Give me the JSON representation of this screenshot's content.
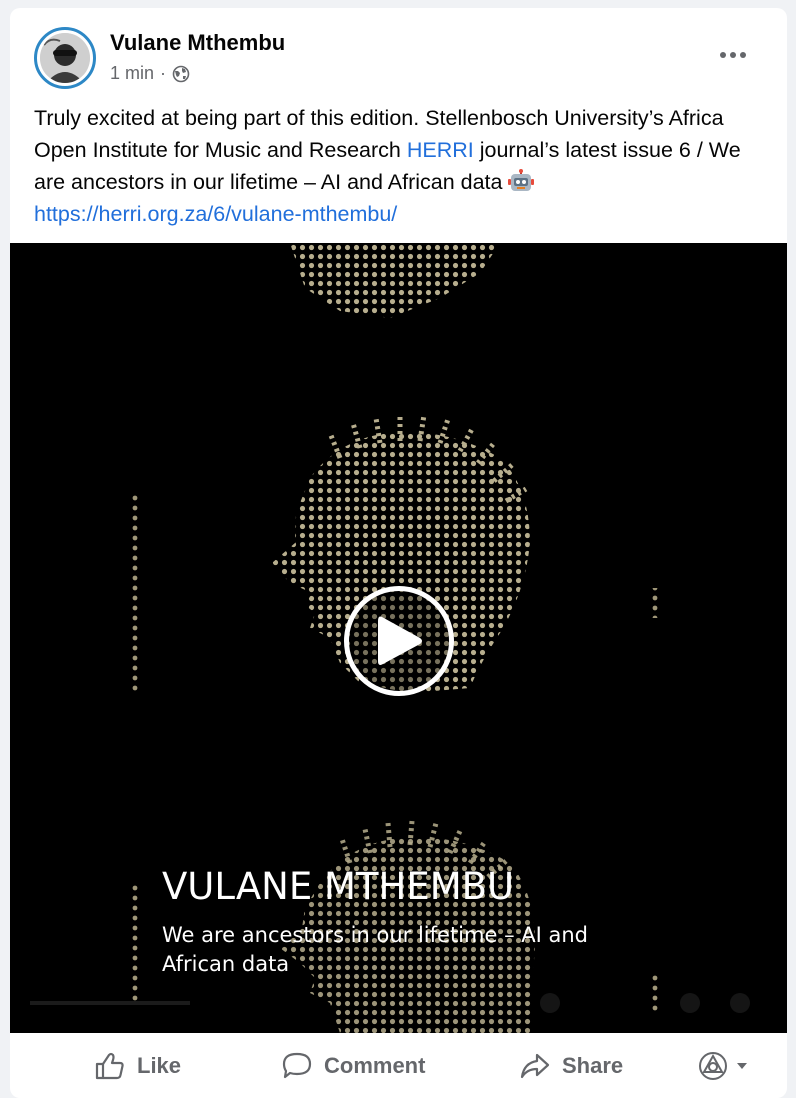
{
  "post": {
    "author": "Vulane Mthembu",
    "time": "1 min",
    "separator": "·",
    "privacy_icon": "globe-icon",
    "text_part1": "Truly excited at being part of this edition. Stellenbosch University’s Africa Open Institute for Music and Research ",
    "link_herri": "HERRI",
    "text_part2": " journal’s  latest issue 6 / We are ancestors in our lifetime – AI and African data ",
    "emoji": "robot-emoji",
    "url": "https://herri.org.za/6/vulane-mthembu/"
  },
  "video": {
    "title": "VULANE MTHEMBU",
    "subtitle": "We are ancestors in our lifetime – AI and African data"
  },
  "actions": {
    "like": "Like",
    "comment": "Comment",
    "share": "Share"
  }
}
